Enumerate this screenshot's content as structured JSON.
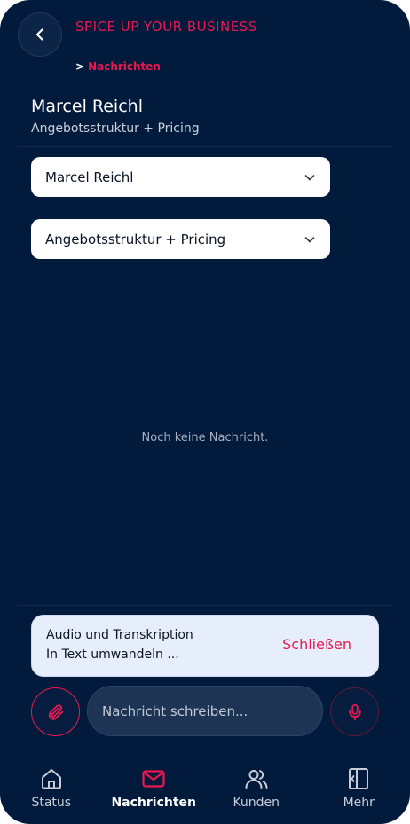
{
  "header": {
    "brand": "SPICE UP YOUR BUSINESS",
    "breadcrumb_sep": ">",
    "breadcrumb_current": "Nachrichten"
  },
  "contact": {
    "name": "Marcel Reichl",
    "subtitle": "Angebotsstruktur + Pricing"
  },
  "selects": {
    "contact_value": "Marcel Reichl",
    "topic_value": "Angebotsstruktur + Pricing"
  },
  "messages": {
    "empty_text": "Noch keine Nachricht."
  },
  "audio_card": {
    "title": "Audio und Transkription",
    "subtitle": "In Text umwandeln ...",
    "close_label": "Schließen"
  },
  "composer": {
    "placeholder": "Nachricht schreiben..."
  },
  "tabs": [
    {
      "label": "Status",
      "icon": "home-icon",
      "active": false
    },
    {
      "label": "Nachrichten",
      "icon": "mail-icon",
      "active": true
    },
    {
      "label": "Kunden",
      "icon": "users-icon",
      "active": false
    },
    {
      "label": "Mehr",
      "icon": "sidebar-panel-icon",
      "active": false
    }
  ],
  "colors": {
    "background": "#021a3b",
    "accent": "#e8194f",
    "card": "#e6eefc"
  }
}
